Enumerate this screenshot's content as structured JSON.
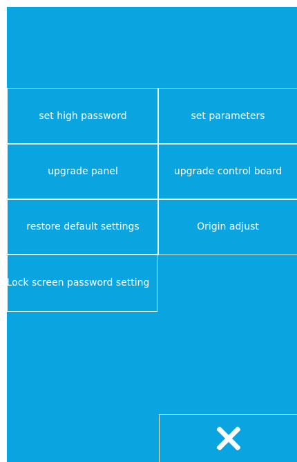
{
  "menu": {
    "set_high_password": "set high password",
    "set_parameters": "set parameters",
    "upgrade_panel": "upgrade panel",
    "upgrade_control_board": "upgrade control board",
    "restore_default_settings": "restore default settings",
    "origin_adjust": "Origin adjust",
    "lock_screen_password_setting": "Lock screen password setting"
  },
  "close_icon": "close-icon",
  "colors": {
    "background": "#0aa5e1",
    "border": "#e9f6fd",
    "text": "#ffffff"
  }
}
